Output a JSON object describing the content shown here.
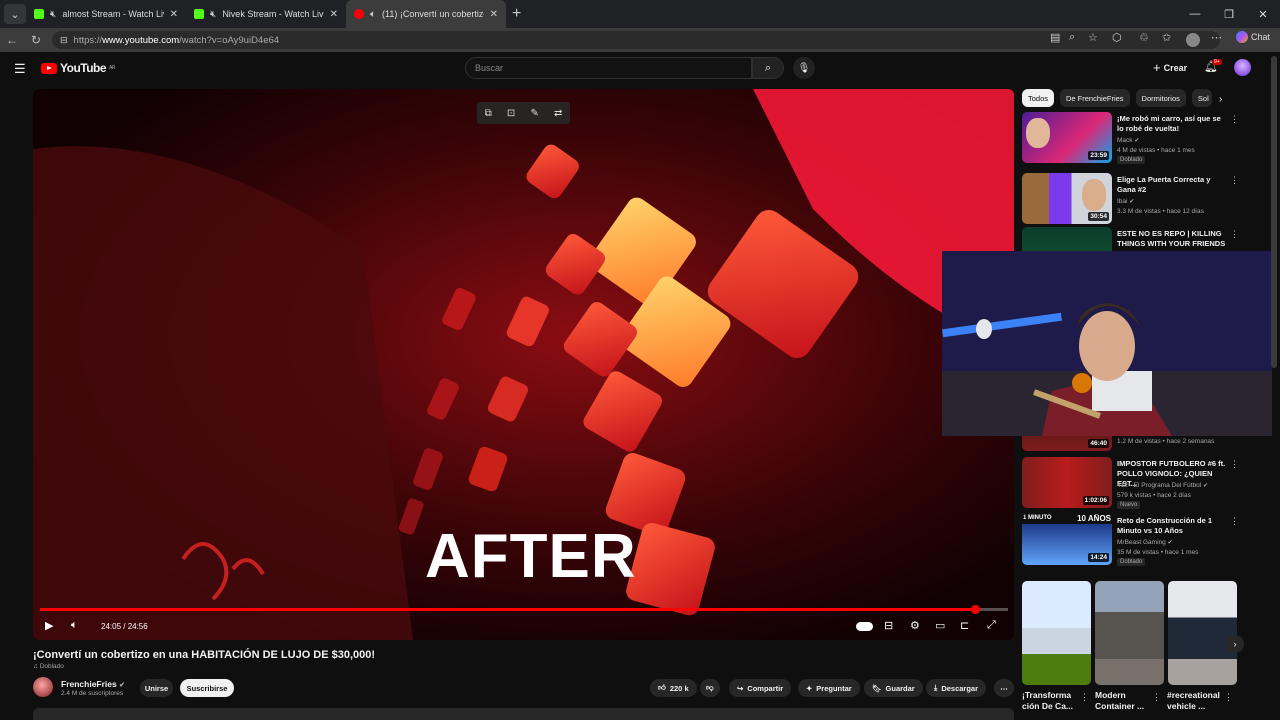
{
  "browser": {
    "tabs": [
      {
        "title": "almost Stream - Watch Live on",
        "muted": true,
        "favicon_color": "#53fc18"
      },
      {
        "title": "Nivek Stream - Watch Live on",
        "muted": true,
        "favicon_color": "#53fc18"
      },
      {
        "title": "(11) ¡Convertí un cobertizo en",
        "muted": false,
        "favicon_color": "#ff0000"
      }
    ],
    "url_prefix": "https://",
    "url_host": "www.youtube.com",
    "url_path": "/watch?v=oAy9uiD4e64",
    "chat_label": "Chat"
  },
  "header": {
    "logo_text": "YouTube",
    "logo_region": "AR",
    "search_placeholder": "Buscar",
    "create_label": "Crear",
    "notification_count": "9+"
  },
  "player": {
    "overlay_text": "AFTER",
    "time_display": "24:05 / 24:56",
    "progress": 0.966
  },
  "video": {
    "title": "¡Convertí un cobertizo en una HABITACIÓN DE LUJO DE $30,000!",
    "dubbed": "Doblado",
    "channel": "FrenchieFries",
    "subscribers": "2.4 M de suscriptores",
    "join_label": "Unirse",
    "subscribe_label": "Suscribirse",
    "likes": "220 k",
    "share_label": "Compartir",
    "ask_label": "Preguntar",
    "save_label": "Guardar",
    "download_label": "Descargar"
  },
  "sidebar": {
    "chips": [
      "Todos",
      "De FrenchieFries",
      "Dormitorios",
      "Sol"
    ],
    "recommendations": [
      {
        "title": "¡Me robó mi carro, así que se lo robé de vuelta!",
        "channel": "Mack",
        "meta": "4 M de vistas • hace 1 mes",
        "tag": "Doblado",
        "duration": "23:59"
      },
      {
        "title": "Elige La Puerta Correcta y Gana #2",
        "channel": "Ibai",
        "meta": "3.3 M de vistas • hace 12 días",
        "tag": "",
        "duration": "30:54"
      },
      {
        "title": "ESTE NO ES REPO | KILLING THINGS WITH YOUR FRIENDS",
        "channel": "",
        "meta": "",
        "tag": "",
        "duration": ""
      },
      {
        "title": "",
        "channel": "",
        "meta": "1.2 M de vistas • hace 2 semanas",
        "tag": "",
        "duration": "46:40"
      },
      {
        "title": "IMPOSTOR FUTBOLERO #6 ft. POLLO VIGNOLO: ¿QUIEN EST...",
        "channel": "412 - El Programa Del Fútbol",
        "meta": "579 k vistas • hace 2 días",
        "tag": "Nuevo",
        "duration": "1:02:06"
      },
      {
        "title": "Reto de Construcción de 1 Minuto vs 10 Años",
        "channel": "MrBeast Gaming",
        "meta": "35 M de vistas • hace 1 mes",
        "tag": "Doblado",
        "duration": "14:24",
        "thumb_text_left": "1 MINUTO",
        "thumb_text_right": "10 AÑOS"
      }
    ],
    "shorts": [
      {
        "title": "¡Transforma ción De Ca..."
      },
      {
        "title": "Modern Container ..."
      },
      {
        "title": "#recreational vehicle ..."
      }
    ]
  }
}
